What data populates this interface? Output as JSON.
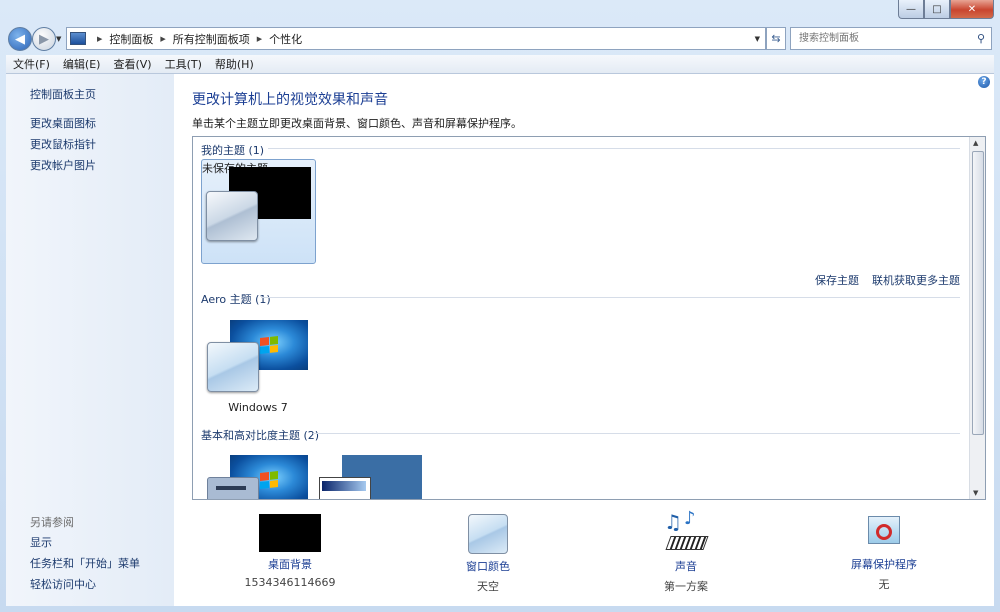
{
  "window": {
    "minimize_glyph": "—",
    "maximize_glyph": "□",
    "close_glyph": "✕"
  },
  "address": {
    "breadcrumbs": [
      "控制面板",
      "所有控制面板项",
      "个性化"
    ],
    "search_placeholder": "搜索控制面板"
  },
  "menu": [
    "文件(F)",
    "编辑(E)",
    "查看(V)",
    "工具(T)",
    "帮助(H)"
  ],
  "sidebar": {
    "home": "控制面板主页",
    "links": [
      "更改桌面图标",
      "更改鼠标指针",
      "更改帐户图片"
    ],
    "see_also_title": "另请参阅",
    "see_also_links": [
      "显示",
      "任务栏和「开始」菜单",
      "轻松访问中心"
    ]
  },
  "main": {
    "title": "更改计算机上的视觉效果和声音",
    "description": "单击某个主题立即更改桌面背景、窗口颜色、声音和屏幕保护程序。",
    "groups": {
      "my_themes": "我的主题 (1)",
      "aero_themes": "Aero 主题 (1)",
      "basic_themes": "基本和高对比度主题 (2)"
    },
    "themes": {
      "unsaved": "未保存的主题",
      "windows7": "Windows 7"
    },
    "links": {
      "save_theme": "保存主题",
      "get_more_online": "联机获取更多主题"
    }
  },
  "bottom": [
    {
      "label": "桌面背景",
      "value": "1534346114669"
    },
    {
      "label": "窗口颜色",
      "value": "天空"
    },
    {
      "label": "声音",
      "value": "第一方案"
    },
    {
      "label": "屏幕保护程序",
      "value": "无"
    }
  ],
  "colors": {
    "link": "#1c3a6d",
    "title": "#1c3f94",
    "selected_tile": "#cde2f7"
  }
}
